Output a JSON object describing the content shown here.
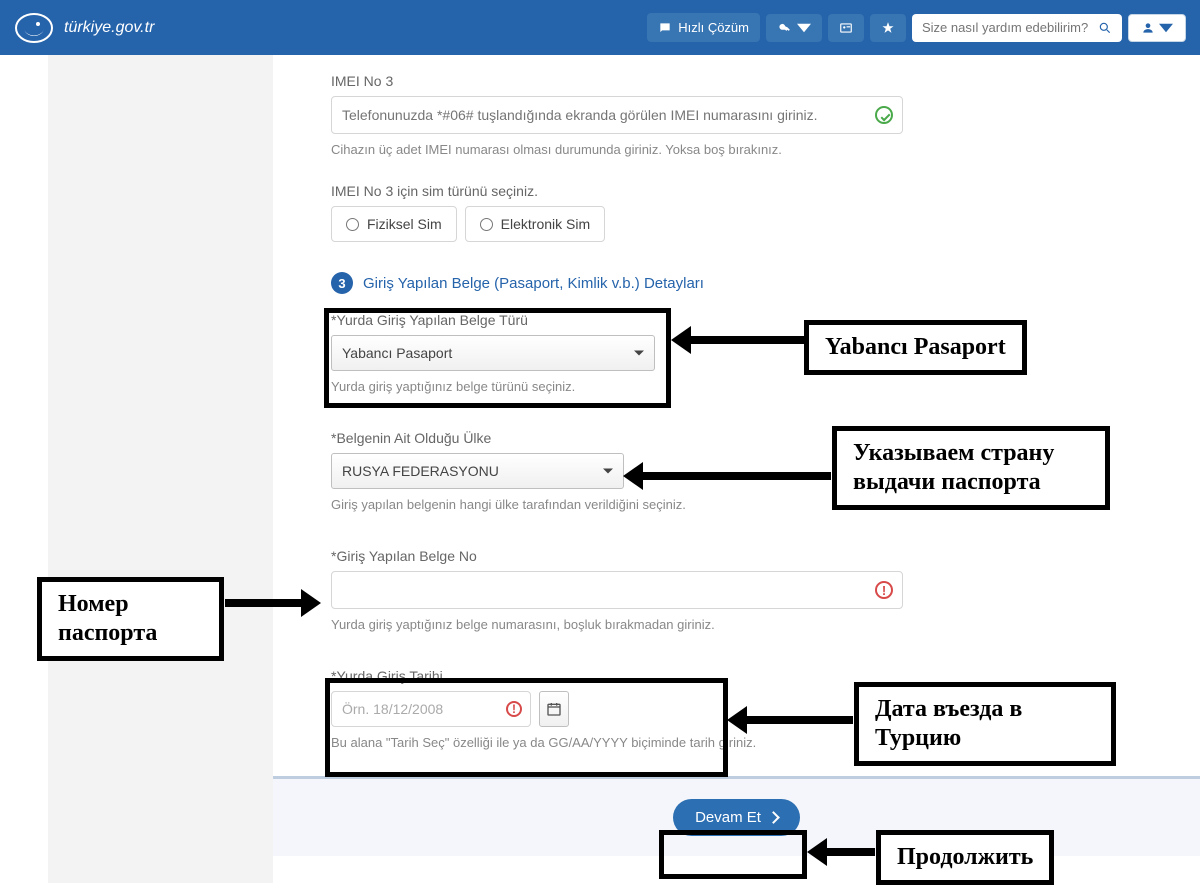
{
  "header": {
    "site": "türkiye.gov.tr",
    "quick_label": "Hızlı Çözüm",
    "search_placeholder": "Size nasıl yardım edebilirim?"
  },
  "imei3": {
    "label": "IMEI No 3",
    "placeholder": "Telefonunuzda *#06# tuşlandığında ekranda görülen IMEI numarasını giriniz.",
    "helper": "Cihazın üç adet IMEI numarası olması durumunda giriniz. Yoksa boş bırakınız."
  },
  "sim_type": {
    "label": "IMEI No 3 için sim türünü seçiniz.",
    "opt1": "Fiziksel Sim",
    "opt2": "Elektronik Sim"
  },
  "section3": {
    "number": "3",
    "title": "Giriş Yapılan Belge (Pasaport, Kimlik v.b.) Detayları"
  },
  "doc_type": {
    "label": "Yurda Giriş Yapılan Belge Türü",
    "value": "Yabancı Pasaport",
    "helper": "Yurda giriş yaptığınız belge türünü seçiniz."
  },
  "doc_country": {
    "label": "Belgenin Ait Olduğu Ülke",
    "value": "RUSYA FEDERASYONU",
    "helper": "Giriş yapılan belgenin hangi ülke tarafından verildiğini seçiniz."
  },
  "doc_no": {
    "label": "Giriş Yapılan Belge No",
    "value": "",
    "helper": "Yurda giriş yaptığınız belge numarasını, boşluk bırakmadan giriniz."
  },
  "entry_date": {
    "label": "Yurda Giriş Tarihi",
    "placeholder": "Örn. 18/12/2008",
    "helper": "Bu alana \"Tarih Seç\" özelliği ile ya da GG/AA/YYYY biçiminde tarih giriniz."
  },
  "buttons": {
    "continue": "Devam Et"
  },
  "callouts": {
    "c1": "Yabancı Pasaport",
    "c2": "Указываем страну выдачи паспорта",
    "c3": "Номер паспорта",
    "c4": "Дата въезда в Турцию",
    "c5": "Продолжить"
  }
}
